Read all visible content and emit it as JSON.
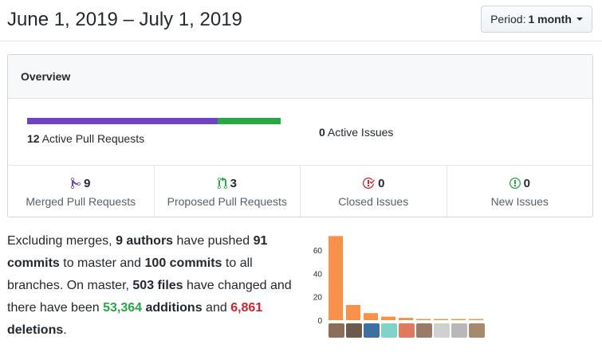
{
  "header": {
    "date_range": "June 1, 2019 – July 1, 2019",
    "period_label": "Period:",
    "period_value": "1 month"
  },
  "overview": {
    "title": "Overview",
    "pull_requests": {
      "count": "12",
      "label": "Active Pull Requests",
      "merged_fraction": 0.75,
      "open_fraction": 0.25
    },
    "issues": {
      "count": "0",
      "label": "Active Issues"
    },
    "stats": [
      {
        "name": "merged",
        "count": "9",
        "label": "Merged Pull Requests",
        "icon": "git-merge-icon",
        "color": "#6f42c1"
      },
      {
        "name": "proposed",
        "count": "3",
        "label": "Proposed Pull Requests",
        "icon": "git-pull-request-icon",
        "color": "#28a745"
      },
      {
        "name": "closed",
        "count": "0",
        "label": "Closed Issues",
        "icon": "issue-closed-icon",
        "color": "#cb2431"
      },
      {
        "name": "new",
        "count": "0",
        "label": "New Issues",
        "icon": "issue-opened-icon",
        "color": "#28a745"
      }
    ]
  },
  "summary": {
    "t1": "Excluding merges, ",
    "authors": "9 authors",
    "t2": " have pushed ",
    "commits_master": "91 commits",
    "t3": " to master and ",
    "commits_all": "100 commits",
    "t4": " to all branches. On master, ",
    "files": "503 files",
    "t5": " have changed and there have been ",
    "additions_num": "53,364",
    "additions_word": " additions",
    "t6": " and ",
    "deletions_num": "6,861",
    "deletions_word": " deletions",
    "t7": "."
  },
  "chart_data": {
    "type": "bar",
    "categories": [
      "author1",
      "author2",
      "author3",
      "author4",
      "author5",
      "author6",
      "author7",
      "author8",
      "author9"
    ],
    "values": [
      72,
      13,
      6,
      3,
      2,
      1,
      1,
      1,
      1
    ],
    "ylim": [
      0,
      75
    ],
    "yticks": [
      "0",
      "20",
      "40",
      "60"
    ],
    "bar_color": "#f9914b",
    "grid": false
  },
  "avatar_colors": [
    "#8a6e5a",
    "#6b5a4e",
    "#3d6fa0",
    "#7fd3c8",
    "#e07a5f",
    "#9a7b6a",
    "#d0d0d0",
    "#b8b8b8",
    "#a68a6d"
  ]
}
